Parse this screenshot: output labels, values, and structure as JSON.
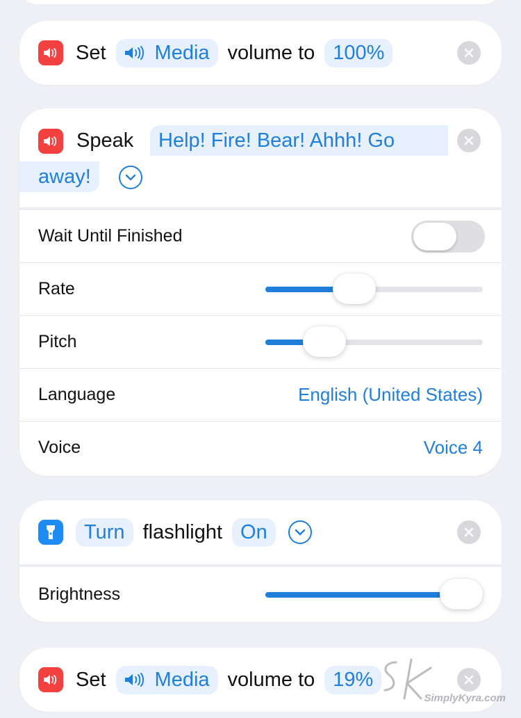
{
  "card1": {
    "verb": "Set",
    "target": "Media",
    "middle": "volume to",
    "value": "100%"
  },
  "speak": {
    "verb": "Speak",
    "text_line1": "Help! Fire! Bear! Ahhh! Go",
    "text_line2": "away!",
    "params": {
      "wait_label": "Wait Until Finished",
      "wait_on": false,
      "rate_label": "Rate",
      "rate_level": 0.41,
      "pitch_label": "Pitch",
      "pitch_level": 0.27,
      "language_label": "Language",
      "language_value": "English (United States)",
      "voice_label": "Voice",
      "voice_value": "Voice 4"
    }
  },
  "flash": {
    "verb": "Turn",
    "word": "flashlight",
    "state": "On",
    "brightness_label": "Brightness",
    "brightness_level": 0.97
  },
  "card4": {
    "verb": "Set",
    "target": "Media",
    "middle": "volume to",
    "value": "19%"
  },
  "watermark": "SimplyKyra.com",
  "colors": {
    "accent": "#1f7fdb",
    "token_bg": "#e7f1fd",
    "red_icon": "#f2413f",
    "blue_icon": "#1f8cf5",
    "page_bg": "#eef0f6"
  }
}
